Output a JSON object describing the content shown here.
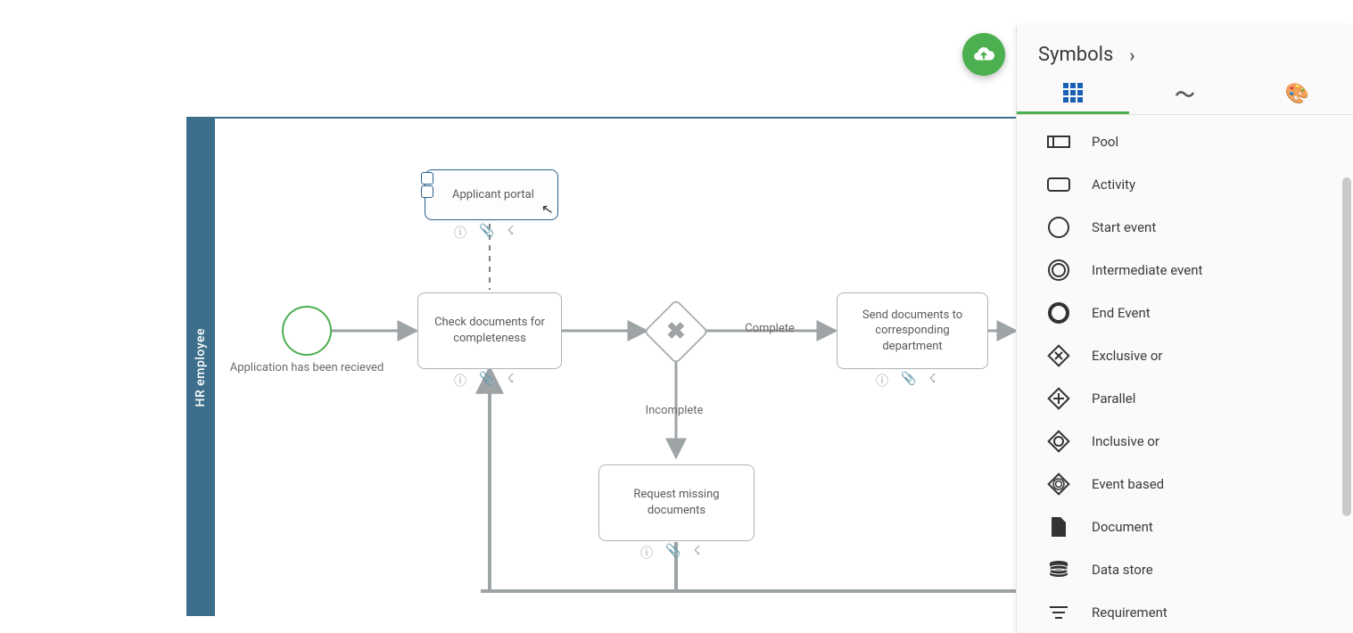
{
  "pool": {
    "lane_label": "HR employee"
  },
  "nodes": {
    "start": {
      "label": "Application has been recieved"
    },
    "applicant": {
      "label": "Applicant portal"
    },
    "check": {
      "label": "Check documents for completeness"
    },
    "send": {
      "label": "Send documents to corresponding department"
    },
    "request": {
      "label": "Request missing documents"
    }
  },
  "edges": {
    "complete": "Complete",
    "incomplete": "Incomplete"
  },
  "fab": {
    "tooltip": "Publish"
  },
  "panel": {
    "title": "Symbols",
    "tabs": [
      "symbols",
      "freehand",
      "style"
    ],
    "active_tab": 0,
    "items": [
      {
        "id": "pool",
        "label": "Pool"
      },
      {
        "id": "activity",
        "label": "Activity"
      },
      {
        "id": "start-event",
        "label": "Start event"
      },
      {
        "id": "intermediate",
        "label": "Intermediate event"
      },
      {
        "id": "end-event",
        "label": "End Event"
      },
      {
        "id": "exclusive-or",
        "label": "Exclusive or"
      },
      {
        "id": "parallel",
        "label": "Parallel"
      },
      {
        "id": "inclusive-or",
        "label": "Inclusive or"
      },
      {
        "id": "event-based",
        "label": "Event based"
      },
      {
        "id": "document",
        "label": "Document"
      },
      {
        "id": "data-store",
        "label": "Data store"
      },
      {
        "id": "requirement",
        "label": "Requirement"
      }
    ]
  },
  "colors": {
    "pool": "#3d6f8c",
    "accent": "#4caf50",
    "node_border": "#aeb3b6",
    "selected": "#2b5f8a"
  }
}
